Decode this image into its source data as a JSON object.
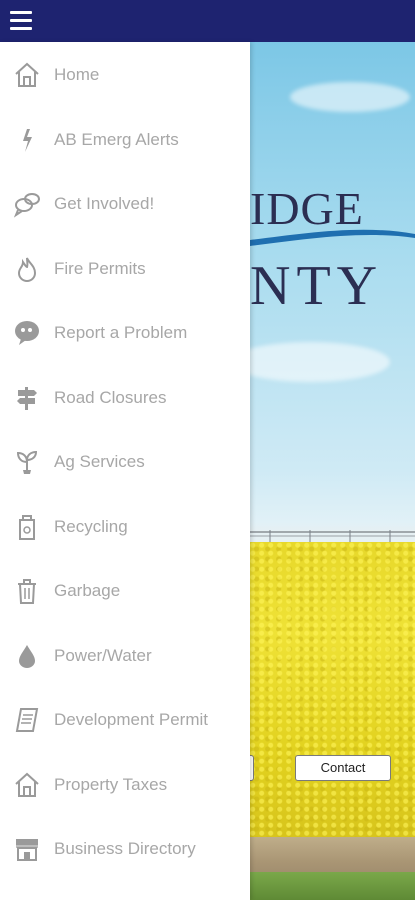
{
  "topbar": {
    "menu_icon": "hamburger-menu-icon",
    "color": "#1e2370"
  },
  "menu": {
    "items": [
      {
        "label": "Home",
        "icon": "home-icon"
      },
      {
        "label": "AB Emerg Alerts",
        "icon": "lightning-icon"
      },
      {
        "label": "Get Involved!",
        "icon": "chat-bubbles-icon"
      },
      {
        "label": "Fire Permits",
        "icon": "flame-icon"
      },
      {
        "label": "Report a Problem",
        "icon": "quote-bubble-icon"
      },
      {
        "label": "Road Closures",
        "icon": "signpost-icon"
      },
      {
        "label": "Ag Services",
        "icon": "sprout-icon"
      },
      {
        "label": "Recycling",
        "icon": "recycle-bin-icon"
      },
      {
        "label": "Garbage",
        "icon": "trash-can-icon"
      },
      {
        "label": "Power/Water",
        "icon": "water-drop-icon"
      },
      {
        "label": "Development Permit",
        "icon": "document-icon"
      },
      {
        "label": "Property Taxes",
        "icon": "home-icon"
      },
      {
        "label": "Business Directory",
        "icon": "storefront-icon"
      }
    ]
  },
  "background": {
    "logo_text_top": "IDGE",
    "logo_text_bottom": "NTY",
    "contact_label": "Contact"
  }
}
